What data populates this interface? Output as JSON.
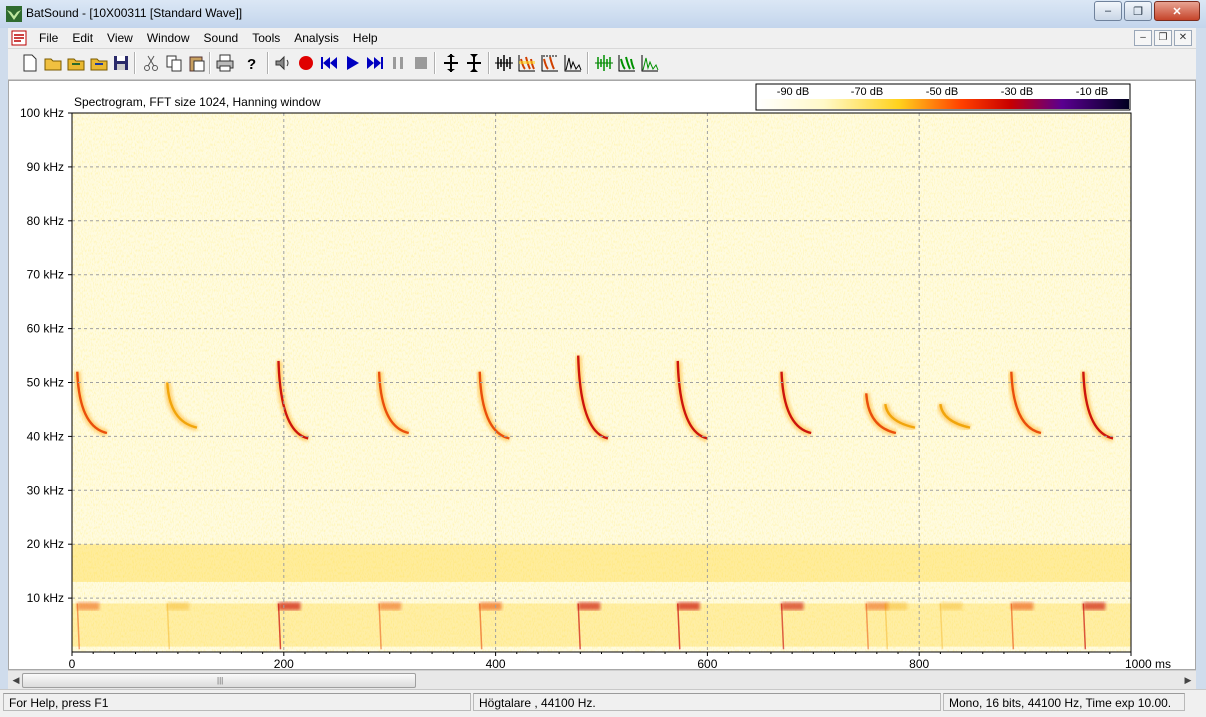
{
  "window": {
    "title": "BatSound - [10X00311 [Standard Wave]]",
    "app_icon": "batsound-logo-icon"
  },
  "menu": {
    "items": [
      {
        "label": "File"
      },
      {
        "label": "Edit"
      },
      {
        "label": "View"
      },
      {
        "label": "Window"
      },
      {
        "label": "Sound"
      },
      {
        "label": "Tools"
      },
      {
        "label": "Analysis"
      },
      {
        "label": "Help"
      }
    ]
  },
  "toolbar": {
    "buttons": [
      {
        "icon": "new-file-icon"
      },
      {
        "icon": "open-folder-icon"
      },
      {
        "icon": "open-folder-2-icon"
      },
      {
        "icon": "open-folder-3-icon"
      },
      {
        "icon": "save-icon"
      },
      {
        "icon": "cut-icon"
      },
      {
        "icon": "copy-icon"
      },
      {
        "icon": "paste-icon"
      },
      {
        "icon": "print-icon"
      },
      {
        "icon": "help-icon"
      },
      {
        "icon": "speaker-icon"
      },
      {
        "icon": "record-icon"
      },
      {
        "icon": "rewind-icon"
      },
      {
        "icon": "play-icon"
      },
      {
        "icon": "fast-forward-icon"
      },
      {
        "icon": "pause-icon"
      },
      {
        "icon": "stop-icon"
      },
      {
        "icon": "zoom-vertical-in-icon"
      },
      {
        "icon": "zoom-vertical-out-icon"
      },
      {
        "icon": "waveform-view-icon"
      },
      {
        "icon": "spectrogram-view-icon"
      },
      {
        "icon": "spectrogram-marked-icon"
      },
      {
        "icon": "power-spectrum-icon"
      },
      {
        "icon": "waveform-green-icon"
      },
      {
        "icon": "spectrogram-green-icon"
      },
      {
        "icon": "spectrum-green-icon"
      }
    ]
  },
  "plot": {
    "title": "Spectrogram, FFT size 1024, Hanning window",
    "y_ticks": [
      "100 kHz",
      "90 kHz",
      "80 kHz",
      "70 kHz",
      "60 kHz",
      "50 kHz",
      "40 kHz",
      "30 kHz",
      "20 kHz",
      "10 kHz"
    ],
    "x_ticks": [
      "0",
      "200",
      "400",
      "600",
      "800",
      "1000 ms"
    ],
    "color_scale_labels": [
      "-90 dB",
      "-70 dB",
      "-50 dB",
      "-30 dB",
      "-10 dB"
    ],
    "colors": {
      "low": "#fffbe0",
      "mid": "#ffd21e",
      "high": "#e00000",
      "top": "#1000a0"
    }
  },
  "chart_data": {
    "type": "heatmap",
    "title": "Spectrogram, FFT size 1024, Hanning window",
    "x_unit": "ms",
    "y_unit": "kHz",
    "xlim": [
      0,
      1000
    ],
    "ylim": [
      0,
      100
    ],
    "grid": true,
    "colorbar": {
      "labels": [
        "-90 dB",
        "-70 dB",
        "-50 dB",
        "-30 dB",
        "-10 dB"
      ],
      "range_db": [
        -90,
        -10
      ],
      "placement": "top-right"
    },
    "calls": [
      {
        "t_ms": 5,
        "f_high_khz": 52,
        "f_low_khz": 41,
        "intensity": 0.6
      },
      {
        "t_ms": 90,
        "f_high_khz": 50,
        "f_low_khz": 42,
        "intensity": 0.45
      },
      {
        "t_ms": 195,
        "f_high_khz": 54,
        "f_low_khz": 40,
        "intensity": 0.85
      },
      {
        "t_ms": 290,
        "f_high_khz": 52,
        "f_low_khz": 41,
        "intensity": 0.6
      },
      {
        "t_ms": 385,
        "f_high_khz": 52,
        "f_low_khz": 40,
        "intensity": 0.7
      },
      {
        "t_ms": 478,
        "f_high_khz": 55,
        "f_low_khz": 40,
        "intensity": 0.8
      },
      {
        "t_ms": 572,
        "f_high_khz": 54,
        "f_low_khz": 40,
        "intensity": 0.85
      },
      {
        "t_ms": 670,
        "f_high_khz": 52,
        "f_low_khz": 41,
        "intensity": 0.75
      },
      {
        "t_ms": 750,
        "f_high_khz": 48,
        "f_low_khz": 41,
        "intensity": 0.6
      },
      {
        "t_ms": 768,
        "f_high_khz": 46,
        "f_low_khz": 42,
        "intensity": 0.45
      },
      {
        "t_ms": 820,
        "f_high_khz": 46,
        "f_low_khz": 42,
        "intensity": 0.4
      },
      {
        "t_ms": 887,
        "f_high_khz": 52,
        "f_low_khz": 41,
        "intensity": 0.7
      },
      {
        "t_ms": 955,
        "f_high_khz": 52,
        "f_low_khz": 40,
        "intensity": 0.8
      }
    ],
    "noise_bands": [
      {
        "f_low_khz": 13,
        "f_high_khz": 20,
        "intensity": 0.35
      },
      {
        "f_low_khz": 1,
        "f_high_khz": 9,
        "intensity": 0.3
      }
    ]
  },
  "status": {
    "help": "For Help, press F1",
    "output": "Högtalare ,  44100 Hz.",
    "format": "Mono, 16 bits, 44100 Hz, Time exp 10.00."
  }
}
